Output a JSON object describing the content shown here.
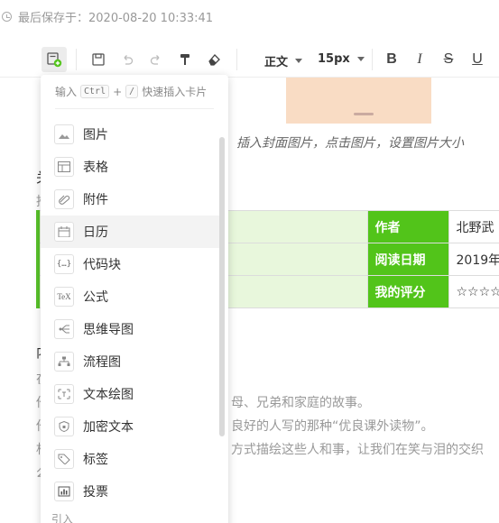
{
  "status": {
    "last_saved": "最后保存于：2020-08-20 10:33:41"
  },
  "toolbar": {
    "insert_icon": "insert-card-icon",
    "paragraph_style": "正文",
    "font_size": "15px",
    "bold": "B",
    "italic": "I",
    "strike": "S",
    "underline": "U",
    "accent_color": "#52c41a"
  },
  "document": {
    "cover_caption": "插入封面图片，点击图片，设置图片大小",
    "frag_1": "关",
    "frag_2": "推",
    "frag_3": "内",
    "table": {
      "rows": [
        {
          "label": "作者",
          "value": "北野武"
        },
        {
          "label": "阅读日期",
          "value": "2019年"
        },
        {
          "label": "我的评分",
          "value": "☆☆☆☆"
        }
      ]
    },
    "lines": [
      "在",
      "他",
      "母、兄弟和家庭的故事。",
      "他",
      "良好的人写的那种“优良课外读物”。",
      "相",
      "方式描绘这些人和事，让我们在笑与泪的交织",
      "么"
    ]
  },
  "menu": {
    "hint_prefix": "输入",
    "hint_key1": "Ctrl",
    "hint_plus": "+",
    "hint_key2": "/",
    "hint_suffix": "快速插入卡片",
    "items": [
      {
        "label": "图片",
        "icon": "image-icon"
      },
      {
        "label": "表格",
        "icon": "table-icon"
      },
      {
        "label": "附件",
        "icon": "attachment-icon"
      },
      {
        "label": "日历",
        "icon": "calendar-icon"
      },
      {
        "label": "代码块",
        "icon": "code-block-icon"
      },
      {
        "label": "公式",
        "icon": "formula-icon"
      },
      {
        "label": "思维导图",
        "icon": "mindmap-icon"
      },
      {
        "label": "流程图",
        "icon": "flowchart-icon"
      },
      {
        "label": "文本绘图",
        "icon": "text-drawing-icon"
      },
      {
        "label": "加密文本",
        "icon": "encrypted-text-icon"
      },
      {
        "label": "标签",
        "icon": "tag-icon"
      },
      {
        "label": "投票",
        "icon": "vote-icon"
      }
    ],
    "group_label": "引入"
  }
}
